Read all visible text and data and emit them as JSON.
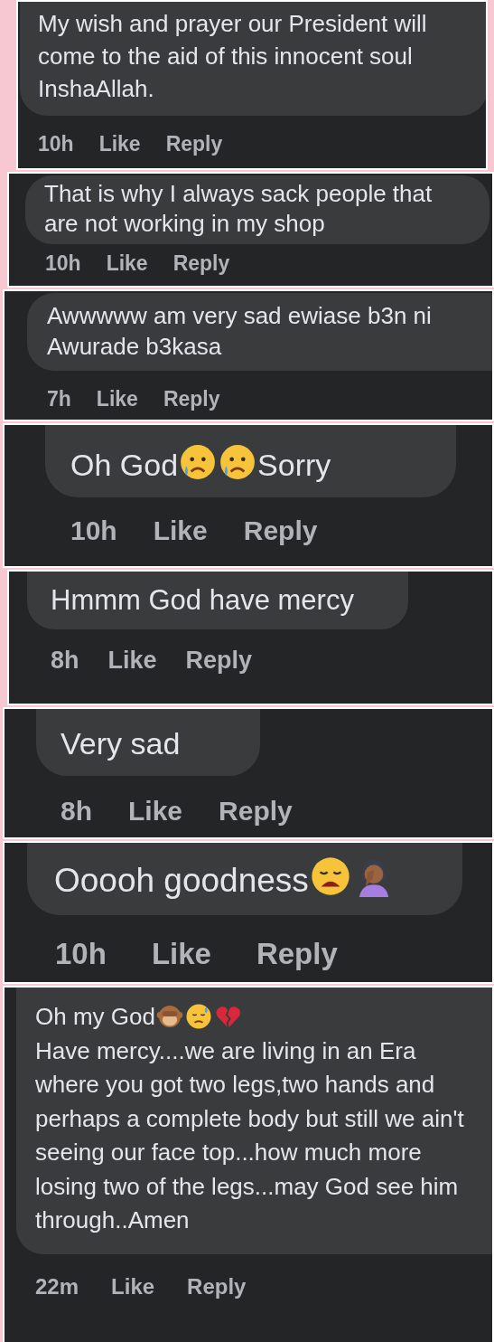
{
  "comments": [
    {
      "lines": [
        [
          {
            "kind": "text",
            "text": "My wish and prayer our President will come to the aid of this innocent soul InshaAllah."
          }
        ]
      ],
      "time": "10h",
      "like": "Like",
      "reply": "Reply"
    },
    {
      "lines": [
        [
          {
            "kind": "text",
            "text": "That is why I always sack people that are not working in my shop"
          }
        ]
      ],
      "time": "10h",
      "like": "Like",
      "reply": "Reply"
    },
    {
      "lines": [
        [
          {
            "kind": "text",
            "text": "Awwwww am very sad ewiase b3n ni Awurade b3kasa"
          }
        ]
      ],
      "time": "7h",
      "like": "Like",
      "reply": "Reply"
    },
    {
      "lines": [
        [
          {
            "kind": "text",
            "text": "Oh God"
          },
          {
            "kind": "crying"
          },
          {
            "kind": "crying"
          },
          {
            "kind": "text",
            "text": "Sorry"
          }
        ]
      ],
      "time": "10h",
      "like": "Like",
      "reply": "Reply"
    },
    {
      "lines": [
        [
          {
            "kind": "text",
            "text": "Hmmm God have mercy"
          }
        ]
      ],
      "time": "8h",
      "like": "Like",
      "reply": "Reply"
    },
    {
      "lines": [
        [
          {
            "kind": "text",
            "text": "Very sad"
          }
        ]
      ],
      "time": "8h",
      "like": "Like",
      "reply": "Reply"
    },
    {
      "lines": [
        [
          {
            "kind": "text",
            "text": "Ooooh goodness"
          },
          {
            "kind": "weary"
          },
          {
            "kind": "facepalm"
          }
        ]
      ],
      "time": "10h",
      "like": "Like",
      "reply": "Reply"
    },
    {
      "lines": [
        [
          {
            "kind": "text",
            "text": "Oh my God"
          },
          {
            "kind": "monkey"
          },
          {
            "kind": "sweat"
          },
          {
            "kind": "broken_heart"
          }
        ],
        [
          {
            "kind": "text",
            "text": "Have mercy....we are living in an Era where you got two legs,two hands and perhaps  a complete body but still we ain't seeing our face top...how much more losing two of the legs...may God see him through..Amen"
          }
        ]
      ],
      "time": "22m",
      "like": "Like",
      "reply": "Reply"
    }
  ]
}
